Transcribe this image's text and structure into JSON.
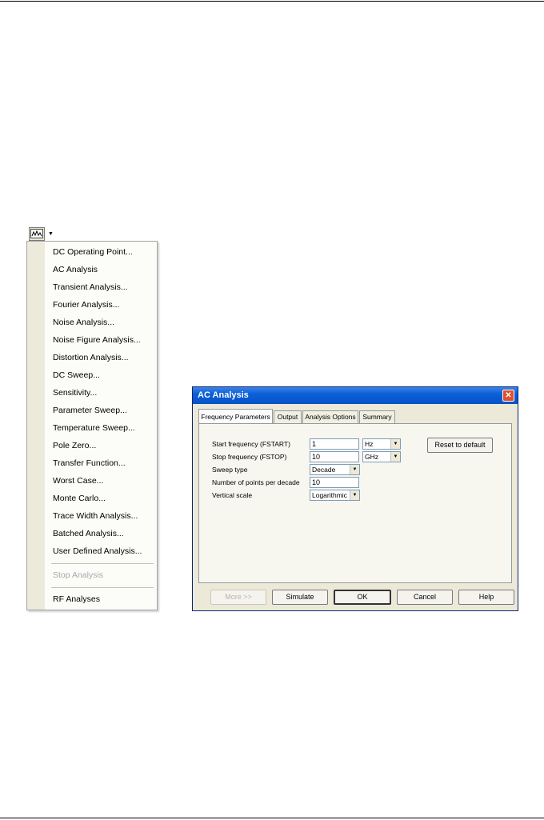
{
  "menu": {
    "items": [
      {
        "label": "DC Operating Point..."
      },
      {
        "label": "AC Analysis"
      },
      {
        "label": "Transient Analysis..."
      },
      {
        "label": "Fourier Analysis..."
      },
      {
        "label": "Noise Analysis..."
      },
      {
        "label": "Noise Figure Analysis..."
      },
      {
        "label": "Distortion Analysis..."
      },
      {
        "label": "DC Sweep..."
      },
      {
        "label": "Sensitivity..."
      },
      {
        "label": "Parameter Sweep..."
      },
      {
        "label": "Temperature Sweep..."
      },
      {
        "label": "Pole Zero..."
      },
      {
        "label": "Transfer Function..."
      },
      {
        "label": "Worst Case..."
      },
      {
        "label": "Monte Carlo..."
      },
      {
        "label": "Trace Width Analysis..."
      },
      {
        "label": "Batched Analysis..."
      },
      {
        "label": "User Defined Analysis..."
      }
    ],
    "stop_label": "Stop Analysis",
    "rf_label": "RF Analyses"
  },
  "dialog": {
    "title": "AC Analysis",
    "close_glyph": "✕",
    "tabs": [
      {
        "label": "Frequency Parameters"
      },
      {
        "label": "Output"
      },
      {
        "label": "Analysis Options"
      },
      {
        "label": "Summary"
      }
    ],
    "fields": {
      "start_label": "Start frequency (FSTART)",
      "start_value": "1",
      "start_unit": "Hz",
      "stop_label": "Stop frequency (FSTOP)",
      "stop_value": "10",
      "stop_unit": "GHz",
      "sweep_label": "Sweep type",
      "sweep_value": "Decade",
      "points_label": "Number of points per decade",
      "points_value": "10",
      "vscale_label": "Vertical scale",
      "vscale_value": "Logarithmic"
    },
    "reset_label": "Reset to default",
    "buttons": {
      "more": "More >>",
      "simulate": "Simulate",
      "ok": "OK",
      "cancel": "Cancel",
      "help": "Help"
    }
  },
  "icons": {
    "analysis": "analysis-graph-icon",
    "dropdown": "chevron-down-icon"
  },
  "colors": {
    "titlebar": "#0a5fd8",
    "dialog_bg": "#ece9d8",
    "close": "#e0502a"
  }
}
